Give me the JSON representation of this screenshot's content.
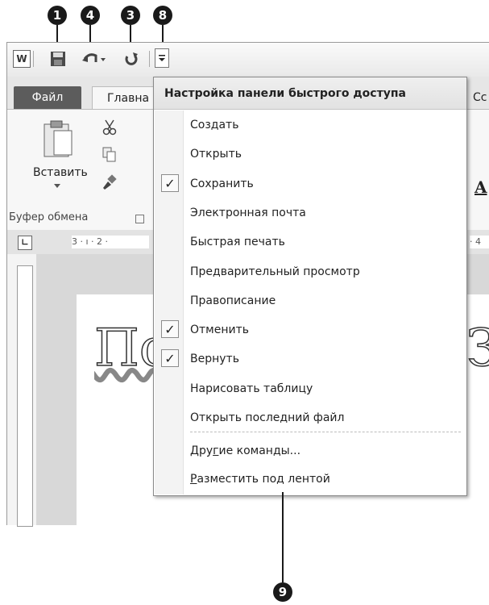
{
  "callouts": [
    "1",
    "4",
    "3",
    "8",
    "9"
  ],
  "app_icon": "W",
  "tabs": {
    "file": "Файл",
    "home": "Главна",
    "right": "Сс"
  },
  "ribbon": {
    "paste_label": "Вставить",
    "clipboard_group": "Буфер обмена",
    "font_letter": "A"
  },
  "ruler": {
    "marks": "3 · ı · 2 ·",
    "right_mark": "· 4"
  },
  "page_text": {
    "left": "Пс",
    "right": "З"
  },
  "menu": {
    "title": "Настройка панели быстрого доступа",
    "items": [
      {
        "label": "Создать",
        "checked": false
      },
      {
        "label": "Открыть",
        "checked": false
      },
      {
        "label": "Сохранить",
        "checked": true
      },
      {
        "label": "Электронная почта",
        "checked": false
      },
      {
        "label": "Быстрая печать",
        "checked": false
      },
      {
        "label": "Предварительный просмотр",
        "checked": false
      },
      {
        "label": "Правописание",
        "checked": false
      },
      {
        "label": "Отменить",
        "checked": true
      },
      {
        "label": "Вернуть",
        "checked": true
      },
      {
        "label": "Нарисовать таблицу",
        "checked": false
      },
      {
        "label": "Открыть последний файл",
        "checked": false
      }
    ],
    "more_commands": {
      "before": "Дру",
      "underlined": "г",
      "after": "ие команды..."
    },
    "place_below": {
      "underlined": "Р",
      "after": "азместить под лентой"
    },
    "check_mark": "✓"
  }
}
